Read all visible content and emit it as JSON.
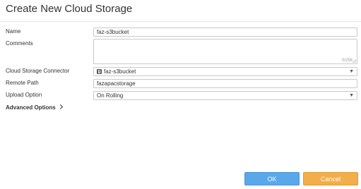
{
  "dialog": {
    "title": "Create New Cloud Storage"
  },
  "form": {
    "name": {
      "label": "Name",
      "value": "faz-s3bucket"
    },
    "comments": {
      "label": "Comments",
      "value": "",
      "counter": "0/256"
    },
    "connector": {
      "label": "Cloud Storage Connector",
      "value": "faz-s3bucket",
      "icon": "s3-bucket-icon"
    },
    "remote_path": {
      "label": "Remote Path",
      "value": "fazapacstorage"
    },
    "upload_option": {
      "label": "Upload Option",
      "value": "On Rolling"
    },
    "advanced_label": "Advanced Options"
  },
  "buttons": {
    "ok": "OK",
    "cancel": "Cancel"
  },
  "colors": {
    "ok": "#5aa8ea",
    "cancel": "#f1ae4b"
  }
}
